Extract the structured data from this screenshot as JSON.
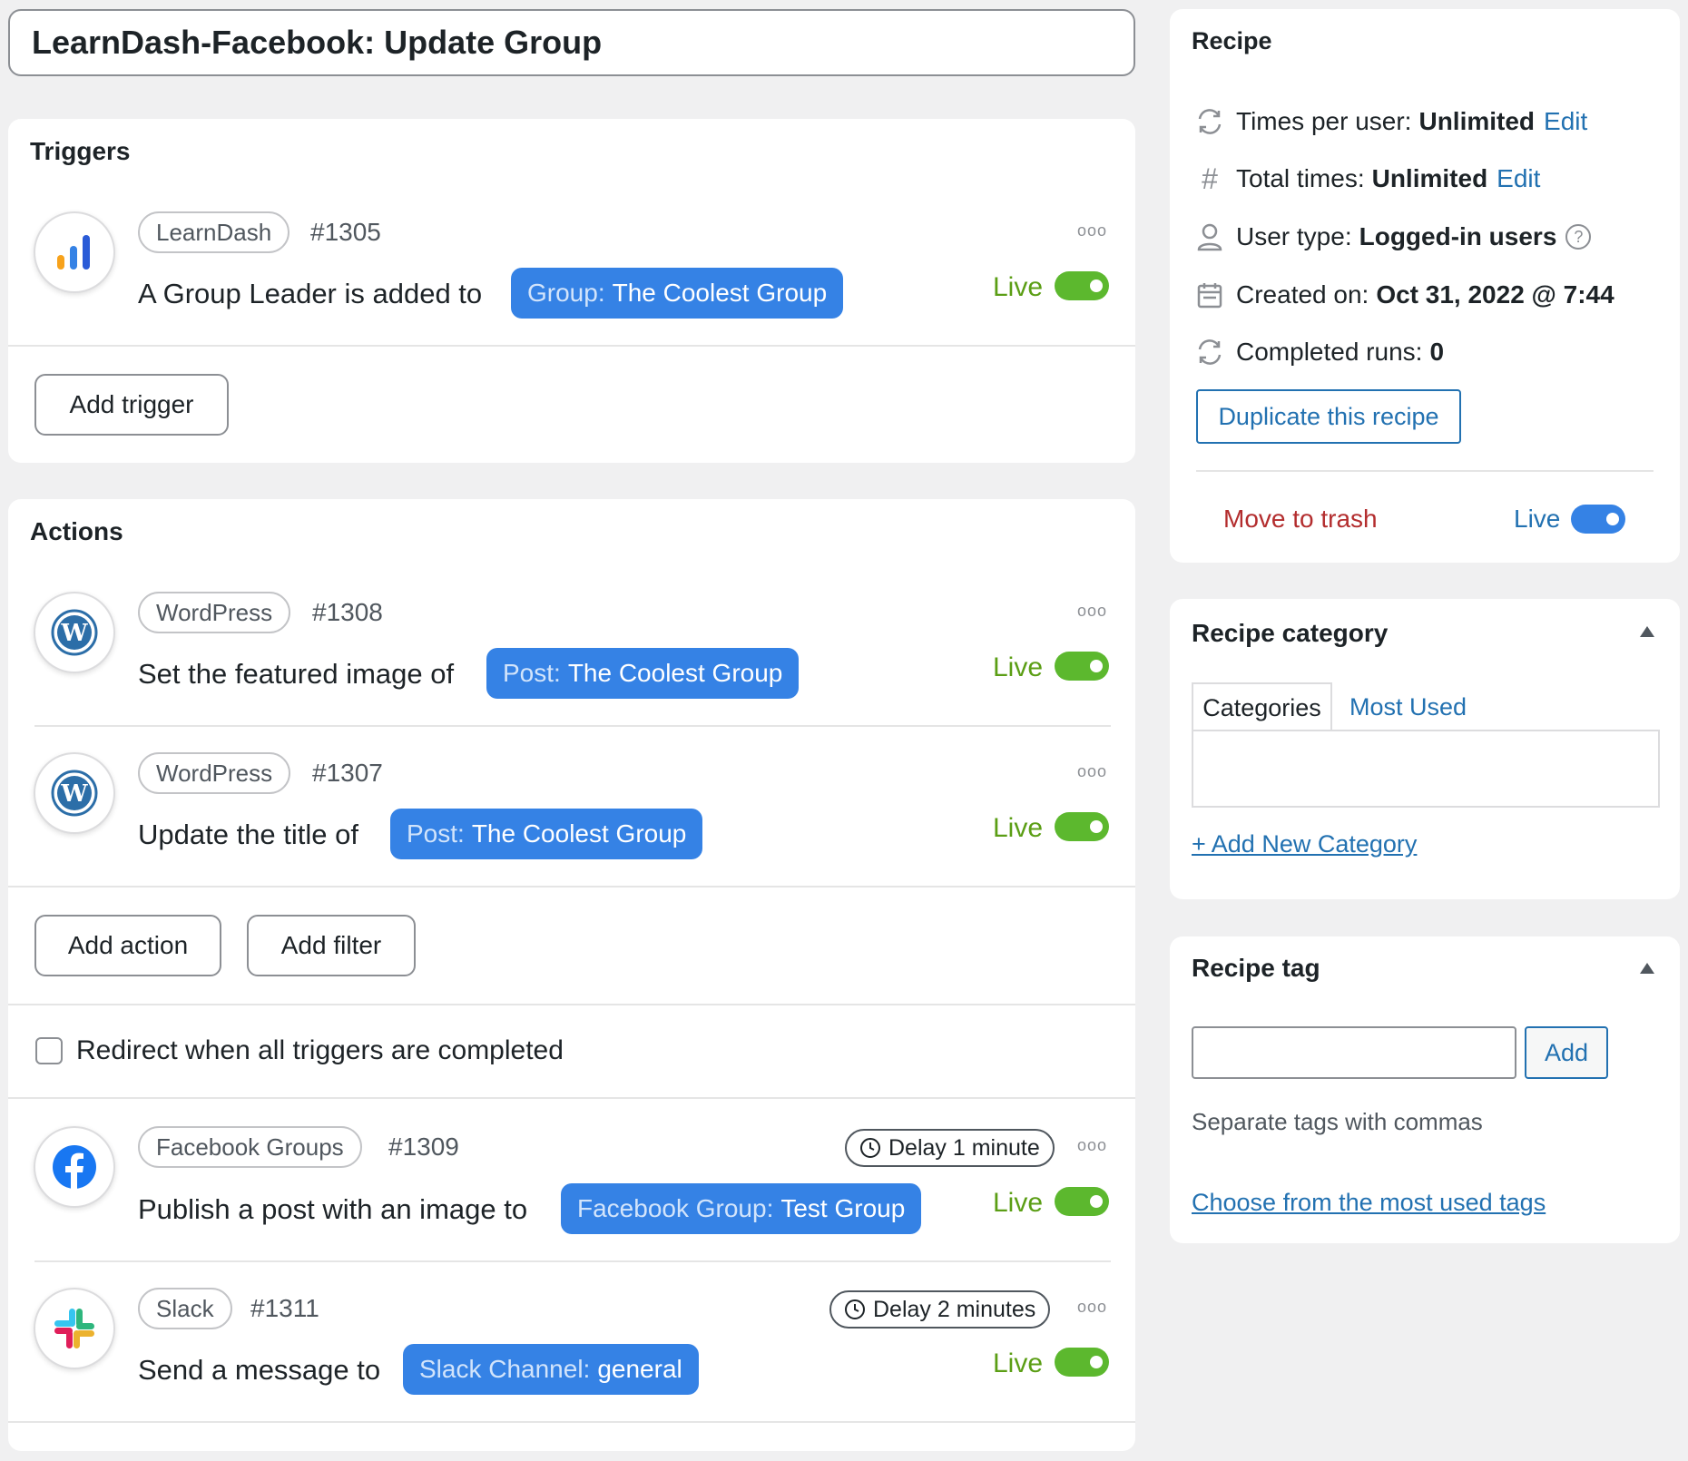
{
  "recipe_title": "LearnDash-Facebook: Update Group",
  "triggers": {
    "heading": "Triggers",
    "items": [
      {
        "source": "LearnDash",
        "id": "#1305",
        "sentence": "A Group Leader is added to",
        "tag_key": "Group:",
        "tag_value": "The Coolest Group",
        "status": "Live",
        "icon": "learndash-icon"
      }
    ],
    "add_trigger": "Add trigger"
  },
  "actions": {
    "heading": "Actions",
    "items": [
      {
        "source": "WordPress",
        "id": "#1308",
        "sentence": "Set the featured image of",
        "tag_key": "Post:",
        "tag_value": "The Coolest Group",
        "status": "Live",
        "icon": "wordpress-icon"
      },
      {
        "source": "WordPress",
        "id": "#1307",
        "sentence": "Update the title of",
        "tag_key": "Post:",
        "tag_value": "The Coolest Group",
        "status": "Live",
        "icon": "wordpress-icon"
      },
      {
        "source": "Facebook Groups",
        "id": "#1309",
        "delay": "Delay 1 minute",
        "sentence": "Publish a post with an image to",
        "tag_key": "Facebook Group:",
        "tag_value": "Test Group",
        "status": "Live",
        "icon": "facebook-icon"
      },
      {
        "source": "Slack",
        "id": "#1311",
        "delay": "Delay 2 minutes",
        "sentence": "Send a message to",
        "tag_key": "Slack Channel:",
        "tag_value": "general",
        "status": "Live",
        "icon": "slack-icon"
      }
    ],
    "add_action": "Add action",
    "add_filter": "Add filter",
    "redirect_label": "Redirect when all triggers are completed"
  },
  "sidebar": {
    "recipe": {
      "heading": "Recipe",
      "times_per_user_label": "Times per user:",
      "times_per_user_value": "Unlimited",
      "total_times_label": "Total times:",
      "total_times_value": "Unlimited",
      "edit": "Edit",
      "user_type_label": "User type:",
      "user_type_value": "Logged-in users",
      "created_on_label": "Created on:",
      "created_on_value": "Oct 31, 2022 @ 7:44",
      "completed_runs_label": "Completed runs:",
      "completed_runs_value": "0",
      "duplicate": "Duplicate this recipe",
      "trash": "Move to trash",
      "status": "Live"
    },
    "category": {
      "heading": "Recipe category",
      "tab_categories": "Categories",
      "tab_most_used": "Most Used",
      "add_new": "+ Add New Category"
    },
    "tag": {
      "heading": "Recipe tag",
      "add": "Add",
      "hint": "Separate tags with commas",
      "choose": "Choose from the most used tags"
    }
  },
  "colors": {
    "accent": "#3582e5",
    "live_green": "#5cb82e",
    "link": "#2271b1",
    "danger": "#b32d2e"
  }
}
